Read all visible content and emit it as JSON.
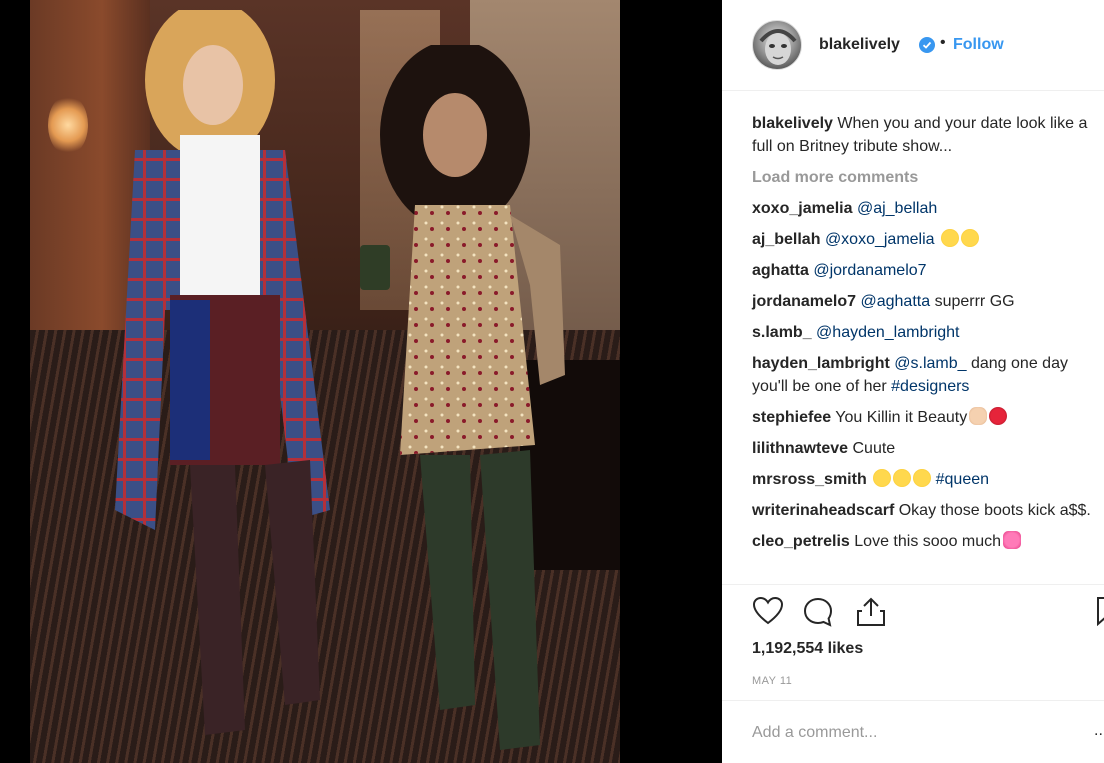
{
  "post": {
    "username": "blakelively",
    "separator": "•",
    "follow_label": "Follow",
    "caption": {
      "user": "blakelively",
      "text": "When you and your date look like a full on Britney tribute show..."
    },
    "load_more_label": "Load more comments",
    "comments": [
      {
        "user": "xoxo_jamelia",
        "parts": [
          "@aj_bellah"
        ]
      },
      {
        "user": "aj_bellah",
        "parts": [
          "@xoxo_jamelia"
        ]
      },
      {
        "user": "aghatta",
        "parts": [
          "@jordanamelo7"
        ]
      },
      {
        "user": "jordanamelo7",
        "mention": "@aghatta",
        "text": "superrr GG"
      },
      {
        "user": "s.lamb_",
        "parts": [
          "@hayden_lambright"
        ]
      },
      {
        "user": "hayden_lambright",
        "mention": "@s.lamb_",
        "text": "dang one day you'll be one of her",
        "hashtag": "#designers"
      },
      {
        "user": "stephiefee",
        "text": "You Killin it Beauty"
      },
      {
        "user": "lilithnawteve",
        "text": "Cuute"
      },
      {
        "user": "mrsross_smith",
        "hashtag": "#queen"
      },
      {
        "user": "writerinaheadscarf",
        "text": "Okay those boots kick a$$."
      },
      {
        "user": "cleo_petrelis",
        "text": "Love this sooo much"
      }
    ],
    "likes": "1,192,554 likes",
    "date": "MAY 11",
    "add_comment_placeholder": "Add a comment...",
    "more_options": "..."
  },
  "icons": {
    "verified": "verified-badge-icon",
    "like": "heart-icon",
    "comment": "comment-icon",
    "share": "share-icon",
    "save": "bookmark-icon"
  },
  "colors": {
    "accent": "#3897f0",
    "text": "#262626",
    "muted": "#999999",
    "mention": "#003569"
  }
}
